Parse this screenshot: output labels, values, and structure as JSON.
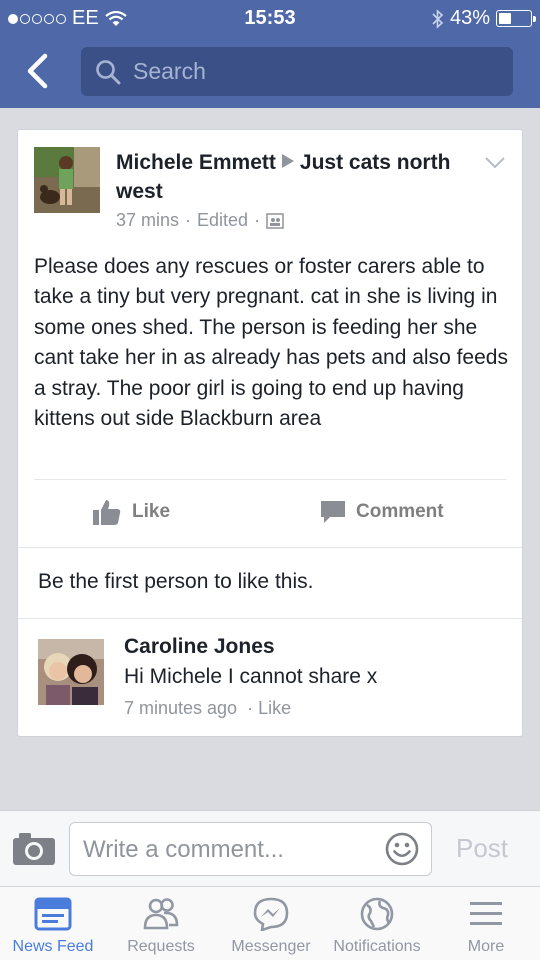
{
  "status_bar": {
    "carrier": "EE",
    "time": "15:53",
    "battery": "43%",
    "battery_level": 0.43
  },
  "header": {
    "search_placeholder": "Search"
  },
  "post": {
    "author": "Michele Emmett",
    "group": "Just cats north west",
    "time": "37 mins",
    "edited": "Edited",
    "privacy_icon": "group-icon",
    "body": "Please does any rescues or foster carers able to take a tiny but very pregnant. cat in she is living in some ones shed. The person is feeding her she cant take her in as already has pets and also feeds a stray. The poor girl is going to end up having kittens out side Blackburn area",
    "like_label": "Like",
    "comment_label": "Comment",
    "likes_summary": "Be the first person to like this."
  },
  "comment": {
    "author": "Caroline Jones",
    "text": "Hi Michele I cannot share x",
    "time": "7 minutes ago",
    "like_label": "Like"
  },
  "composer": {
    "placeholder": "Write a comment...",
    "post_label": "Post"
  },
  "tabbar": {
    "tabs": [
      {
        "label": "News Feed",
        "icon": "news-feed-icon",
        "active": true
      },
      {
        "label": "Requests",
        "icon": "requests-icon",
        "active": false
      },
      {
        "label": "Messenger",
        "icon": "messenger-icon",
        "active": false
      },
      {
        "label": "Notifications",
        "icon": "globe-icon",
        "active": false
      },
      {
        "label": "More",
        "icon": "menu-icon",
        "active": false
      }
    ]
  },
  "colors": {
    "brand_blue": "#4f69a8",
    "active_tab": "#4a7ddb"
  }
}
